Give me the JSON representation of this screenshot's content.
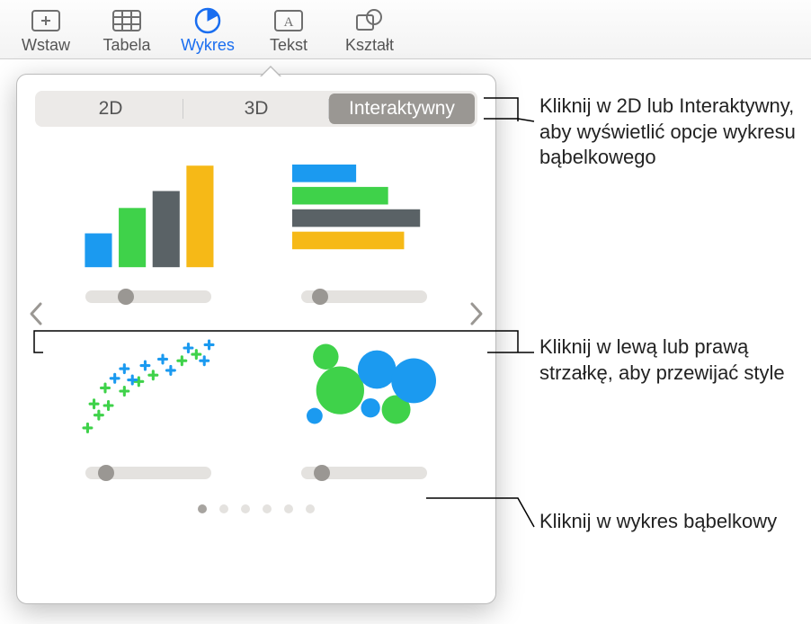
{
  "toolbar": {
    "items": [
      {
        "label": "Wstaw"
      },
      {
        "label": "Tabela"
      },
      {
        "label": "Wykres"
      },
      {
        "label": "Tekst"
      },
      {
        "label": "Kształt"
      }
    ]
  },
  "popover": {
    "tabs": {
      "tab2d": "2D",
      "tab3d": "3D",
      "tabInteractive": "Interaktywny"
    },
    "page_dots": {
      "count": 6,
      "active": 0
    }
  },
  "callouts": {
    "tabs": "Kliknij w 2D lub Interaktywny, aby wyświetlić opcje wykresu bąbelkowego",
    "arrows": "Kliknij w lewą lub prawą strzałkę, aby przewijać style",
    "bubble": "Kliknij w wykres bąbelkowy"
  }
}
